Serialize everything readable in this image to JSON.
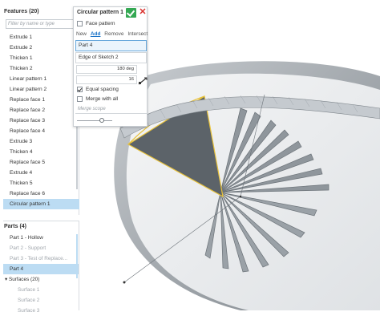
{
  "features_panel": {
    "title": "Features (20)",
    "filter_placeholder": "Filter by name or type",
    "items": [
      {
        "label": "Extrude 1"
      },
      {
        "label": "Extrude 2"
      },
      {
        "label": "Thicken 1"
      },
      {
        "label": "Thicken 2"
      },
      {
        "label": "Linear pattern 1"
      },
      {
        "label": "Linear pattern 2"
      },
      {
        "label": "Replace face 1"
      },
      {
        "label": "Replace face 2"
      },
      {
        "label": "Replace face 3"
      },
      {
        "label": "Replace face 4"
      },
      {
        "label": "Extrude 3"
      },
      {
        "label": "Thicken 4"
      },
      {
        "label": "Replace face 5"
      },
      {
        "label": "Extrude 4"
      },
      {
        "label": "Thicken 5"
      },
      {
        "label": "Replace face 6"
      },
      {
        "label": "Circular pattern 1",
        "selected": true
      }
    ]
  },
  "parts_panel": {
    "title": "Parts (4)",
    "items": [
      {
        "label": "Part 1 - Hollow",
        "style": "normal"
      },
      {
        "label": "Part 2 - Support",
        "style": "dim"
      },
      {
        "label": "Part 3 - Test of Replace...",
        "style": "dim"
      },
      {
        "label": "Part 4",
        "style": "selected"
      },
      {
        "label": "Surfaces (20)",
        "style": "group"
      },
      {
        "label": "Surface 1",
        "style": "sub"
      },
      {
        "label": "Surface 2",
        "style": "sub"
      },
      {
        "label": "Surface 3",
        "style": "sub"
      }
    ]
  },
  "dialog": {
    "title": "Circular pattern 1",
    "face_pattern_label": "Face pattern",
    "face_pattern_checked": false,
    "operations": {
      "new": "New",
      "add": "Add",
      "remove": "Remove",
      "intersect": "Intersect",
      "active": "add"
    },
    "entities_value": "Part 4",
    "axis_value": "Edge of Sketch 2",
    "angle_value": "180 deg",
    "count_value": "16",
    "equal_spacing_label": "Equal spacing",
    "equal_spacing_checked": true,
    "merge_all_label": "Merge with all",
    "merge_all_checked": false,
    "merge_scope_placeholder": "Merge scope",
    "slider_level": 0.7
  },
  "icons": {
    "ok": "checkmark-icon",
    "cancel": "close-icon",
    "flip": "flip-direction-icon",
    "expand": "caret-down-icon"
  },
  "colors": {
    "ok_green": "#34a853",
    "cancel_red": "#d9302c",
    "selection_blue": "#bcdcf3",
    "highlight_yellow": "#e8c23a",
    "model_gray": "#8e9499"
  }
}
